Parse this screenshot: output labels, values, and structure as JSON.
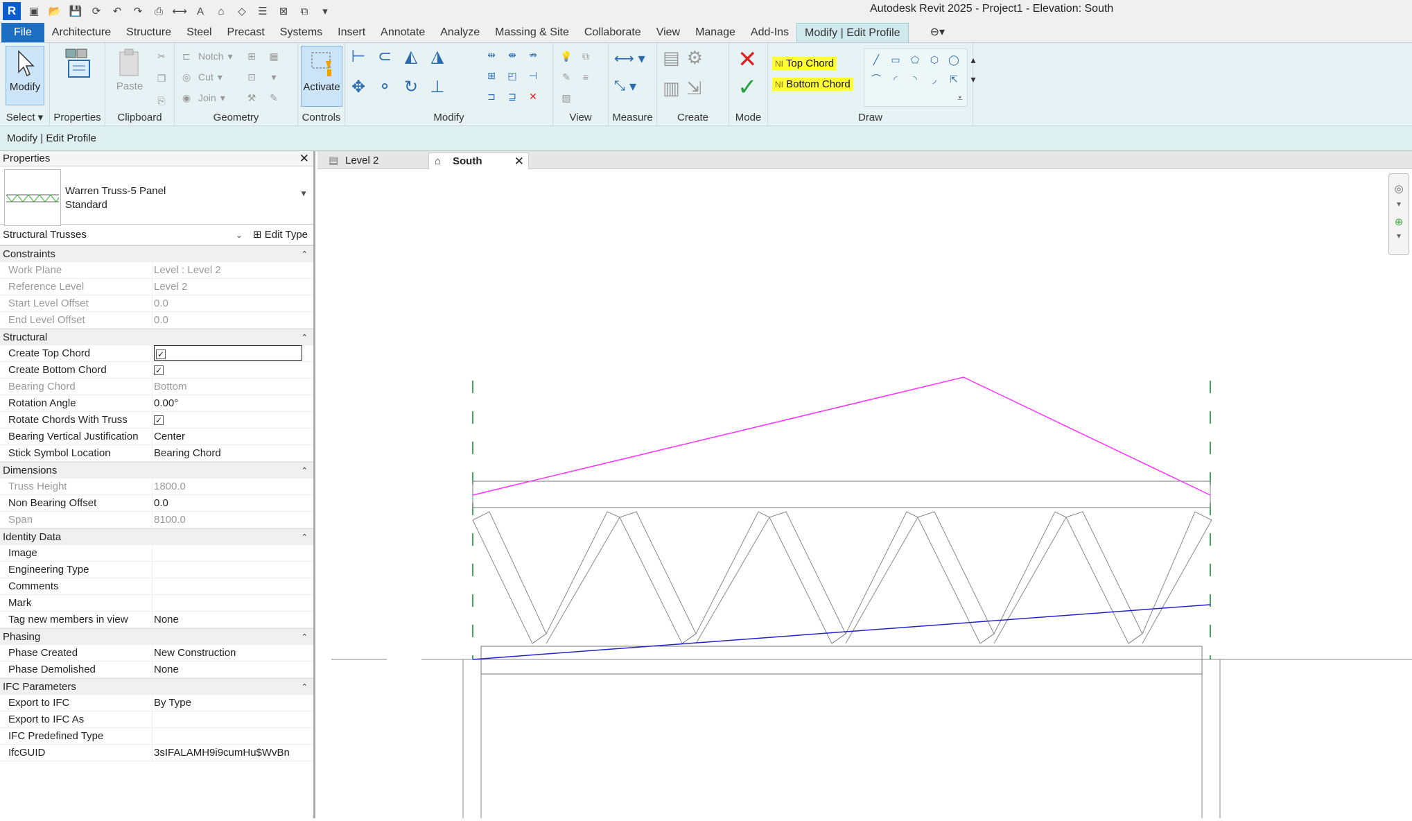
{
  "app": {
    "title": "Autodesk Revit 2025 - Project1 - Elevation: South",
    "logo": "R"
  },
  "ribbon_tabs": [
    "File",
    "Architecture",
    "Structure",
    "Steel",
    "Precast",
    "Systems",
    "Insert",
    "Annotate",
    "Analyze",
    "Massing & Site",
    "Collaborate",
    "View",
    "Manage",
    "Add-Ins",
    "Modify | Edit Profile"
  ],
  "ribbon": {
    "select": {
      "modify_label": "Modify",
      "panel_label": "Select"
    },
    "properties": {
      "panel_label": "Properties"
    },
    "clipboard": {
      "paste_label": "Paste",
      "panel_label": "Clipboard"
    },
    "geometry": {
      "notch_label": "Notch",
      "cut_label": "Cut",
      "join_label": "Join",
      "panel_label": "Geometry"
    },
    "controls": {
      "activate_label": "Activate",
      "panel_label": "Controls"
    },
    "modify": {
      "panel_label": "Modify"
    },
    "view": {
      "panel_label": "View"
    },
    "measure": {
      "panel_label": "Measure"
    },
    "create": {
      "panel_label": "Create"
    },
    "mode": {
      "panel_label": "Mode"
    },
    "draw": {
      "top_chord_label": "Top Chord",
      "bottom_chord_label": "Bottom Chord",
      "panel_label": "Draw"
    }
  },
  "options_bar": {
    "text": "Modify | Edit Profile"
  },
  "properties": {
    "header": "Properties",
    "type_name": "Warren Truss-5 Panel",
    "type_subname": "Standard",
    "category": "Structural Trusses",
    "edit_type_label": "Edit Type",
    "groups": [
      {
        "name": "Constraints",
        "rows": [
          {
            "key": "Work Plane",
            "value": "Level : Level 2",
            "readonly": true
          },
          {
            "key": "Reference Level",
            "value": "Level 2",
            "readonly": true
          },
          {
            "key": "Start Level Offset",
            "value": "0.0",
            "readonly": true
          },
          {
            "key": "End Level Offset",
            "value": "0.0",
            "readonly": true
          }
        ]
      },
      {
        "name": "Structural",
        "rows": [
          {
            "key": "Create Top Chord",
            "value": "checked",
            "readonly": false
          },
          {
            "key": "Create Bottom Chord",
            "value": "checked",
            "readonly": false
          },
          {
            "key": "Bearing Chord",
            "value": "Bottom",
            "readonly": true
          },
          {
            "key": "Rotation Angle",
            "value": "0.00°",
            "readonly": false
          },
          {
            "key": "Rotate Chords With Truss",
            "value": "checked",
            "readonly": false
          },
          {
            "key": "Bearing Vertical Justification",
            "value": "Center",
            "readonly": false
          },
          {
            "key": "Stick Symbol Location",
            "value": "Bearing Chord",
            "readonly": false
          }
        ]
      },
      {
        "name": "Dimensions",
        "rows": [
          {
            "key": "Truss Height",
            "value": "1800.0",
            "readonly": true
          },
          {
            "key": "Non Bearing Offset",
            "value": "0.0",
            "readonly": false
          },
          {
            "key": "Span",
            "value": "8100.0",
            "readonly": true
          }
        ]
      },
      {
        "name": "Identity Data",
        "rows": [
          {
            "key": "Image",
            "value": "",
            "readonly": false
          },
          {
            "key": "Engineering Type",
            "value": "",
            "readonly": false
          },
          {
            "key": "Comments",
            "value": "",
            "readonly": false
          },
          {
            "key": "Mark",
            "value": "",
            "readonly": false
          },
          {
            "key": "Tag new members in view",
            "value": "None",
            "readonly": false
          }
        ]
      },
      {
        "name": "Phasing",
        "rows": [
          {
            "key": "Phase Created",
            "value": "New Construction",
            "readonly": false
          },
          {
            "key": "Phase Demolished",
            "value": "None",
            "readonly": false
          }
        ]
      },
      {
        "name": "IFC Parameters",
        "rows": [
          {
            "key": "Export to IFC",
            "value": "By Type",
            "readonly": false
          },
          {
            "key": "Export to IFC As",
            "value": "",
            "readonly": false
          },
          {
            "key": "IFC Predefined Type",
            "value": "",
            "readonly": false
          },
          {
            "key": "IfcGUID",
            "value": "3sIFALAMH9i9cumHu$WvBn",
            "readonly": false
          }
        ]
      }
    ]
  },
  "view_tabs": [
    {
      "label": "Level 2",
      "active": false
    },
    {
      "label": "South",
      "active": true
    }
  ],
  "colors": {
    "top_chord": "#ff33ff",
    "bottom_chord": "#2222cc",
    "ref_lines": "#0a8a2a",
    "accent": "#1d6fc4",
    "highlight": "#ffff33"
  }
}
